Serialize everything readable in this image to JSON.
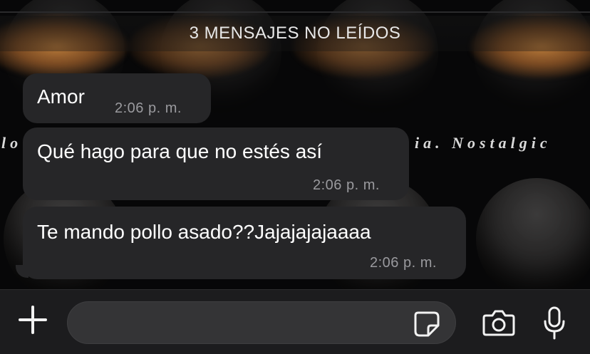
{
  "unread_banner": "3 MENSAJES NO LEÍDOS",
  "wallpaper_text": {
    "left": "lo",
    "right": "ia. Nostalgic"
  },
  "messages": [
    {
      "text": "Amor",
      "time": "2:06 p. m."
    },
    {
      "text": "Qué hago para que no estés así",
      "time": "2:06 p. m."
    },
    {
      "text": "Te mando pollo asado??Jajajajajaaaa",
      "time": "2:06 p. m."
    }
  ],
  "composer": {
    "placeholder": "",
    "value": ""
  },
  "icons": {
    "attach": "plus-icon",
    "sticker": "sticker-icon",
    "camera": "camera-icon",
    "mic": "microphone-icon"
  },
  "colors": {
    "bubble": "#262628",
    "background": "#0b0b0c",
    "input_bar": "#1c1c1e",
    "timestamp": "#9a9a9e"
  }
}
